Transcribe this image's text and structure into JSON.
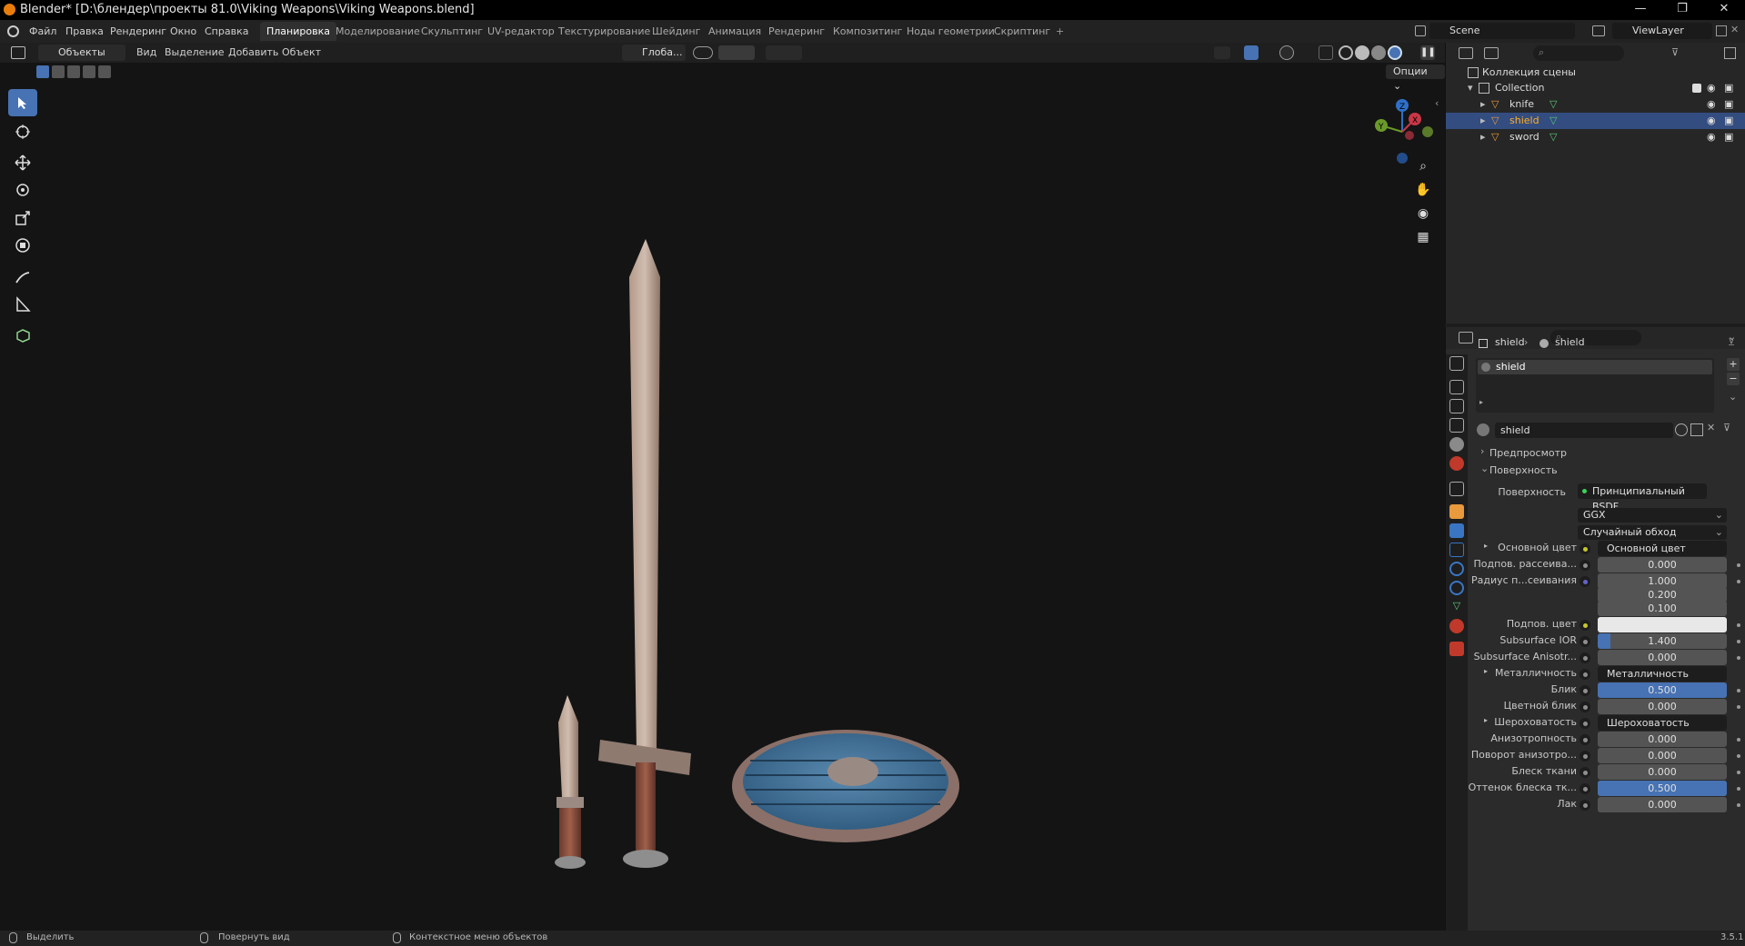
{
  "window": {
    "title": "Blender* [D:\\блендер\\проекты 81.0\\Viking Weapons\\Viking Weapons.blend]",
    "buttons": [
      "—",
      "❐",
      "✕"
    ]
  },
  "menu": {
    "items": [
      "Файл",
      "Правка",
      "Рендеринг",
      "Окно",
      "Справка"
    ],
    "workspaces": [
      "Планировка",
      "Моделирование",
      "Скульптинг",
      "UV-редактор",
      "Текстурирование",
      "Шейдинг",
      "Анимация",
      "Рендеринг",
      "Композитинг",
      "Ноды геометрии",
      "Скриптинг"
    ],
    "active_workspace": "Планировка",
    "add_tab": "+",
    "scene": "Scene",
    "view_layer": "ViewLayer"
  },
  "viewport_header": {
    "mode": "Объекты",
    "items": [
      "Вид",
      "Выделение",
      "Добавить",
      "Объект"
    ],
    "orientation": "Глоба...",
    "options": "Опции"
  },
  "gizmo": {
    "z": "Z",
    "x": "X",
    "y": "Y"
  },
  "outliner": {
    "scene_collection": "Коллекция сцены",
    "collection": "Collection",
    "objects": [
      {
        "name": "knife",
        "selected": false
      },
      {
        "name": "shield",
        "selected": true
      },
      {
        "name": "sword",
        "selected": false
      }
    ]
  },
  "properties": {
    "breadcrumb_object": "shield",
    "breadcrumb_material": "shield",
    "material_slot": "shield",
    "material_name": "shield",
    "panel_preview": "Предпросмотр",
    "panel_surface": "Поверхность",
    "surface_label": "Поверхность",
    "surface_value": "Принципиальный BSDF",
    "distribution": "GGX",
    "subsurface_method": "Случайный обход",
    "rows": [
      {
        "label": "Основной цвет",
        "link": "Основной цвет"
      },
      {
        "label": "Подпов. рассеива...",
        "value": "0.000"
      },
      {
        "label": "Радиус п...сеивания",
        "value": "1.000"
      },
      {
        "label": "",
        "value": "0.200"
      },
      {
        "label": "",
        "value": "0.100"
      },
      {
        "label": "Подпов. цвет",
        "value": ""
      },
      {
        "label": "Subsurface IOR",
        "value": "1.400",
        "fill": 0.1
      },
      {
        "label": "Subsurface Anisotr...",
        "value": "0.000"
      },
      {
        "label": "Металличность",
        "link": "Металличность"
      },
      {
        "label": "Блик",
        "value": "0.500",
        "fill": 1.0
      },
      {
        "label": "Цветной блик",
        "value": "0.000"
      },
      {
        "label": "Шероховатость",
        "link": "Шероховатость"
      },
      {
        "label": "Анизотропность",
        "value": "0.000"
      },
      {
        "label": "Поворот анизотро...",
        "value": "0.000"
      },
      {
        "label": "Блеск ткани",
        "value": "0.000"
      },
      {
        "label": "Оттенок блеска тк...",
        "value": "0.500",
        "fill": 1.0
      },
      {
        "label": "Лак",
        "value": "0.000"
      }
    ]
  },
  "statusbar": {
    "select": "Выделить",
    "rotate": "Повернуть вид",
    "context": "Контекстное меню объектов",
    "version": "3.5.1"
  },
  "colors": {
    "accent": "#4772b3",
    "selection": "#334d80",
    "viewport_bg": "#141414"
  }
}
